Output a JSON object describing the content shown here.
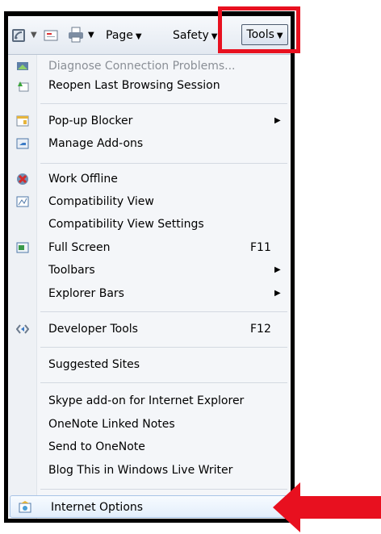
{
  "toolbar": {
    "page_label": "Page",
    "safety_label": "Safety",
    "tools_label": "Tools",
    "caret": "▼"
  },
  "menu": {
    "items": [
      {
        "label": "Diagnose Connection Problems...",
        "icon": "network-diagnose-icon",
        "disabled": true
      },
      {
        "label": "Reopen Last Browsing Session",
        "icon": "reopen-session-icon"
      },
      {
        "label": "Pop-up Blocker",
        "icon": "popup-blocker-icon",
        "submenu": true
      },
      {
        "label": "Manage Add-ons",
        "icon": "manage-addons-icon"
      },
      {
        "label": "Work Offline",
        "icon": "work-offline-icon"
      },
      {
        "label": "Compatibility View",
        "icon": "compatibility-view-icon"
      },
      {
        "label": "Compatibility View Settings"
      },
      {
        "label": "Full Screen",
        "icon": "full-screen-icon",
        "shortcut": "F11"
      },
      {
        "label": "Toolbars",
        "submenu": true
      },
      {
        "label": "Explorer Bars",
        "submenu": true
      },
      {
        "label": "Developer Tools",
        "icon": "developer-tools-icon",
        "shortcut": "F12"
      },
      {
        "label": "Suggested Sites"
      },
      {
        "label": "Skype add-on for Internet Explorer"
      },
      {
        "label": "OneNote Linked Notes"
      },
      {
        "label": "Send to OneNote"
      },
      {
        "label": "Blog This in Windows Live Writer"
      },
      {
        "label": "Internet Options",
        "icon": "internet-options-icon"
      }
    ],
    "submenu_arrow": "▶"
  },
  "colors": {
    "highlight": "#e8101f",
    "menu_bg": "#f4f6f9"
  }
}
